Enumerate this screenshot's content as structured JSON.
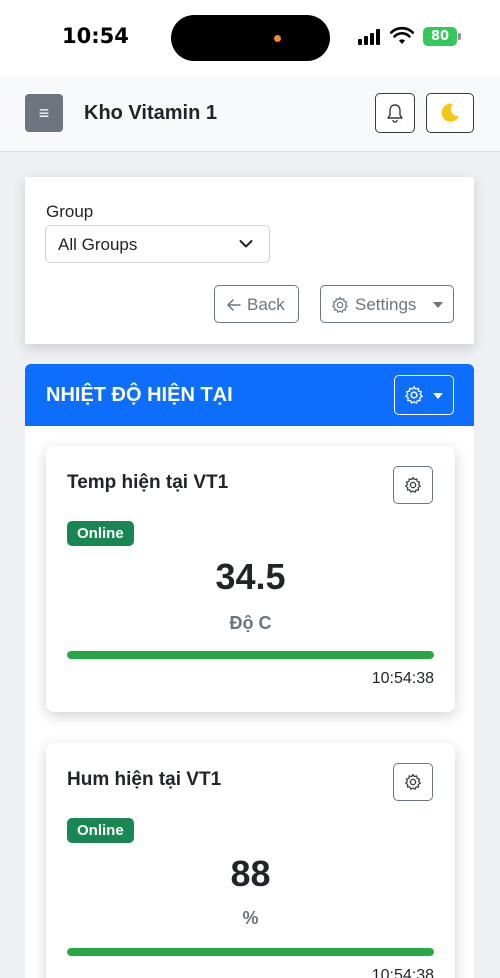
{
  "status": {
    "time": "10:54",
    "battery": "80"
  },
  "navbar": {
    "title": "Kho Vitamin 1",
    "menu_glyph": "≡"
  },
  "filter": {
    "group_label": "Group",
    "group_value": "All Groups",
    "back_label": "Back",
    "settings_label": "Settings"
  },
  "section": {
    "title": "NHIỆT ĐỘ HIỆN TẠI",
    "color": "#0d6efd"
  },
  "widgets": [
    {
      "title": "Temp hiện tại VT1",
      "status": "Online",
      "value": "34.5",
      "unit": "Độ C",
      "progress": 1.0,
      "time": "10:54:38"
    },
    {
      "title": "Hum hiện tại VT1",
      "status": "Online",
      "value": "88",
      "unit": "%",
      "progress": 1.0,
      "time": "10:54:38"
    }
  ],
  "colors": {
    "online": "#198754",
    "progress": "#28a745"
  }
}
